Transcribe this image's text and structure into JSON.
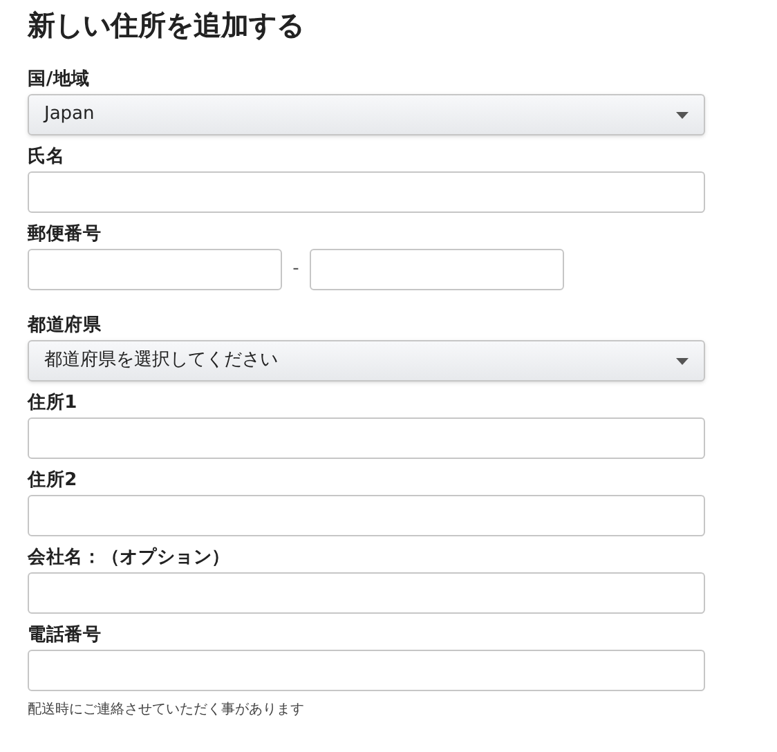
{
  "title": "新しい住所を追加する",
  "fields": [
    {
      "kind": "select",
      "label": "国/地域",
      "value": "Japan"
    },
    {
      "kind": "text",
      "label": "氏名"
    },
    {
      "kind": "postal",
      "label": "郵便番号",
      "separator": "-"
    },
    {
      "kind": "select",
      "label": "都道府県",
      "placeholder": "都道府県を選択してください"
    },
    {
      "kind": "text",
      "label": "住所1"
    },
    {
      "kind": "text",
      "label": "住所2"
    },
    {
      "kind": "text",
      "label": "会社名：（オプション）"
    },
    {
      "kind": "text",
      "label": "電話番号",
      "hint": "配送時にご連絡させていただく事があります"
    }
  ]
}
